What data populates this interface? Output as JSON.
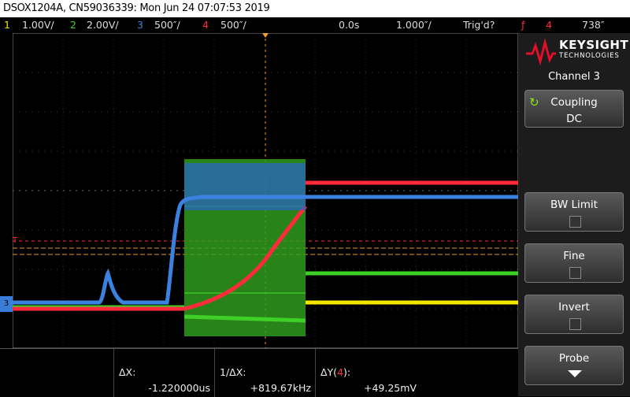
{
  "titlebar": "DSOX1204A, CN59036339: Mon Jun 24 07:07:53 2019",
  "channels": [
    {
      "num": "1",
      "scale": "1.00V/",
      "color": "#f5e600"
    },
    {
      "num": "2",
      "scale": "2.00V/",
      "color": "#3fd028"
    },
    {
      "num": "3",
      "scale": "500″/",
      "color": "#3b82e0"
    },
    {
      "num": "4",
      "scale": "500″/",
      "color": "#ff2a3a"
    }
  ],
  "timebar": {
    "delay": "0.0s",
    "timebase": "1.000″/",
    "status": "Trig'd?",
    "trig_icon": "rising-edge-icon",
    "trig_source": "4",
    "trig_level": "738″"
  },
  "logo": {
    "brand": "KEYSIGHT",
    "sub": "TECHNOLOGIES"
  },
  "menu": {
    "title": "Channel 3",
    "coupling_label": "Coupling",
    "coupling_value": "DC",
    "bw_limit": "BW Limit",
    "fine": "Fine",
    "invert": "Invert",
    "probe": "Probe"
  },
  "trigger_marker": "T",
  "ground_marker": "3",
  "measurements": {
    "dx_label": "ΔX:",
    "dx_value": "-1.220000us",
    "inv_dx_label": "1/ΔX:",
    "inv_dx_value": "+819.67kHz",
    "dy_label": "ΔY(",
    "dy_channel": "4",
    "dy_label_end": "):",
    "dy_value": "+49.25mV"
  }
}
